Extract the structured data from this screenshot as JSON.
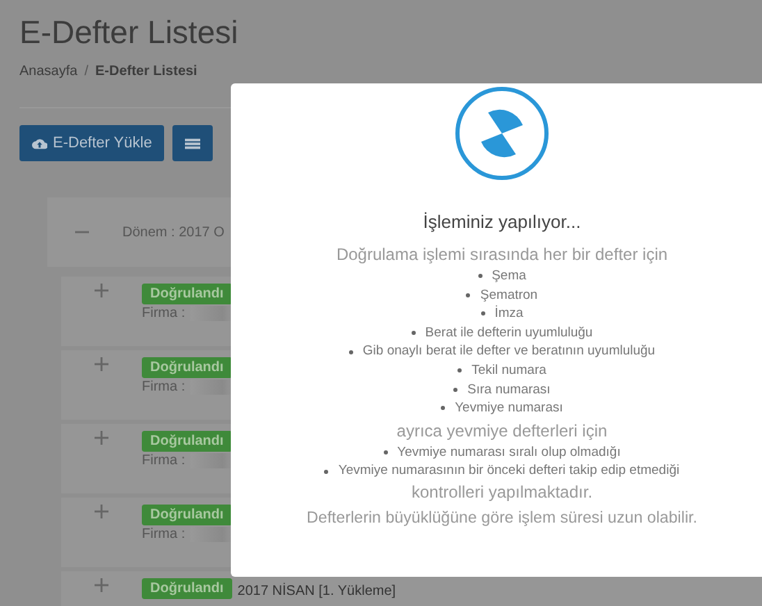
{
  "page": {
    "title": "E-Defter Listesi",
    "breadcrumb": [
      "Anasayfa",
      "E-Defter Listesi"
    ],
    "breadcrumb_separator": "/"
  },
  "toolbar": {
    "buttons": [
      {
        "kind": "upload",
        "label": "E-Defter Yükle"
      },
      {
        "kind": "list"
      }
    ]
  },
  "period": {
    "label": "Dönem : 2017 O",
    "expanded": true
  },
  "rows": [
    {
      "status": "Doğrulandı",
      "firma_label": "Firma :",
      "expanded": false
    },
    {
      "status": "Doğrulandı",
      "firma_label": "Firma :",
      "expanded": false
    },
    {
      "status": "Doğrulandı",
      "firma_label": "Firma :",
      "expanded": false
    },
    {
      "status": "Doğrulandı",
      "firma_label": "Firma :",
      "expanded": false
    },
    {
      "status": "Doğrulandı",
      "title": "2017 NİSAN [1. Yükleme]",
      "expanded": false
    }
  ],
  "modal": {
    "title": "İşleminiz yapılıyor...",
    "intro": "Doğrulama işlemi sırasında her bir defter için",
    "checks": [
      "Şema",
      "Şematron",
      "İmza",
      "Berat ile defterin uyumluluğu",
      "Gib onaylı berat ile defter ve beratının uyumluluğu",
      "Tekil numara",
      "Sıra numarası",
      "Yevmiye numarası"
    ],
    "journal_intro": "ayrıca yevmiye defterleri için",
    "journal_checks": [
      "Yevmiye numarası sıralı olup olmadığı",
      "Yevmiye numarasının bir önceki defteri takip edip etmediği"
    ],
    "outro": "kontrolleri yapılmaktadır.",
    "note": "Defterlerin büyüklüğüne göre işlem süresi uzun olabilir."
  }
}
